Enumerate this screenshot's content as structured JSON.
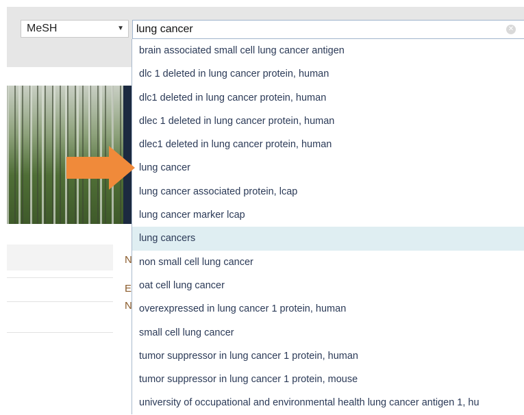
{
  "search": {
    "database": "MeSH",
    "query": "lung cancer"
  },
  "suggestions": [
    {
      "text": "brain associated small cell lung cancer antigen"
    },
    {
      "text": "dlc 1 deleted in lung cancer protein, human"
    },
    {
      "text": "dlc1 deleted in lung cancer protein, human"
    },
    {
      "text": "dlec 1 deleted in lung cancer protein, human"
    },
    {
      "text": "dlec1 deleted in lung cancer protein, human"
    },
    {
      "text": "lung cancer"
    },
    {
      "text": "lung cancer associated protein, lcap"
    },
    {
      "text": "lung cancer marker lcap"
    },
    {
      "text": "lung cancers"
    },
    {
      "text": "non small cell lung cancer"
    },
    {
      "text": "oat cell lung cancer"
    },
    {
      "text": "overexpressed in lung cancer 1 protein, human"
    },
    {
      "text": "small cell lung cancer"
    },
    {
      "text": "tumor suppressor in lung cancer 1 protein, human"
    },
    {
      "text": "tumor suppressor in lung cancer 1 protein, mouse"
    },
    {
      "text": "university of occupational and environmental health lung cancer antigen 1, hu"
    }
  ],
  "highlighted_suggestion": "lung cancers",
  "side_letters": [
    "N",
    "E",
    "N"
  ],
  "colors": {
    "arrow": "#f08a3a",
    "highlight": "#dfeef2",
    "suggestion_text": "#2b3a57"
  },
  "icons": {
    "clear": "clear-circle-icon",
    "caret": "caret-down-icon",
    "pointer": "orange-arrow-icon"
  }
}
